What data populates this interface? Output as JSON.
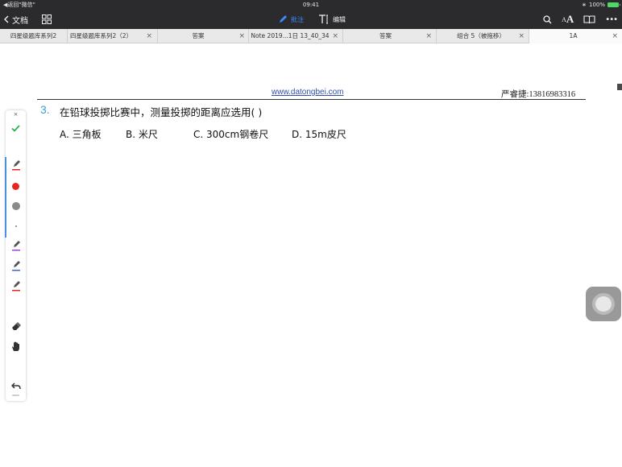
{
  "status_bar": {
    "left": "◀返回\"微信\"",
    "time": "09:41",
    "battery": "100%"
  },
  "toolbar": {
    "back_label": "文档",
    "modes": [
      {
        "label": "批注",
        "icon": "pen-icon",
        "active": true
      },
      {
        "label": "编辑",
        "icon": "text-cursor-icon",
        "active": false
      }
    ],
    "font_size_label": "AA",
    "more_label": "•••"
  },
  "tabs": [
    {
      "label": "四星级题库系列2",
      "close": ""
    },
    {
      "label": "四星级题库系列2（2）",
      "close": "×"
    },
    {
      "label": "答案",
      "close": "×"
    },
    {
      "label": "Note 2019...1日 13_40_34",
      "close": "×"
    },
    {
      "label": "答案",
      "close": "×"
    },
    {
      "label": "组合 5（被拖移）",
      "close": "×"
    },
    {
      "label": "1A",
      "close": "×"
    }
  ],
  "document": {
    "url": "www.datongbei.com",
    "author": "严睿捷:13816983316",
    "question_number": "3.",
    "question_text": "在铅球投掷比赛中，测量投掷的距离应选用(        )",
    "options": [
      "A. 三角板",
      "B. 米尺",
      "C. 300cm钢卷尺",
      "D.  15m皮尺"
    ]
  },
  "pen_panel": {
    "close": "×",
    "colors": {
      "green": "#2ab24a",
      "red": "#e6261f",
      "gray": "#8a8a8a",
      "purple": "#a43fd1",
      "blue": "#3a66d6",
      "accent": "#4a90e2"
    }
  }
}
